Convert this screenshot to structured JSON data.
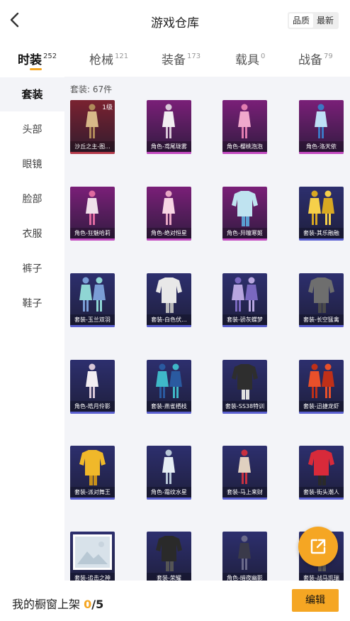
{
  "header": {
    "title": "游戏仓库",
    "sort_options": [
      "品质",
      "最新"
    ],
    "sort_active": "品质"
  },
  "tabs": [
    {
      "label": "时装",
      "count": "252",
      "active": true
    },
    {
      "label": "枪械",
      "count": "121"
    },
    {
      "label": "装备",
      "count": "173"
    },
    {
      "label": "载具",
      "count": "0"
    },
    {
      "label": "战备",
      "count": "79"
    }
  ],
  "sidebar": {
    "items": [
      "套装",
      "头部",
      "眼镜",
      "脸部",
      "衣服",
      "裤子",
      "鞋子"
    ],
    "active": "套装"
  },
  "content": {
    "count_label": "套装: 67件",
    "items": [
      {
        "name": "沙丘之主-图...",
        "level": "1级",
        "bg": "#7a2230",
        "bar": "#b43a4a",
        "icon": "figure-gold"
      },
      {
        "name": "角色-鸢尾珑雾",
        "bg": "#7a1f78",
        "bar": "#c24ac0",
        "icon": "figure-white-dress"
      },
      {
        "name": "角色-樱桃泡泡",
        "bg": "#7a1f78",
        "bar": "#c24ac0",
        "icon": "figure-pink-dress"
      },
      {
        "name": "角色-洛天依",
        "bg": "#7a1f78",
        "bar": "#c24ac0",
        "icon": "figure-blue-dress"
      },
      {
        "name": "角色-狂魅哈莉",
        "bg": "#7a1f78",
        "bar": "#c24ac0",
        "icon": "figure-harley"
      },
      {
        "name": "角色-绝对恒星",
        "bg": "#7a1f78",
        "bar": "#c24ac0",
        "icon": "figure-pink-gown"
      },
      {
        "name": "角色-异瞳寒姬",
        "bg": "#7a1f78",
        "bar": "#c24ac0",
        "icon": "figure-blue-outfit"
      },
      {
        "name": "套装-其乐融融",
        "bg": "#2d2f6e",
        "bar": "#5a5fd0",
        "icon": "figure-yellow-pair"
      },
      {
        "name": "套装-玉兰双羽",
        "bg": "#2d2f6e",
        "bar": "#5a5fd0",
        "icon": "figure-jade-pair"
      },
      {
        "name": "套装-白色伏...",
        "bg": "#2d2f6e",
        "bar": "#5a5fd0",
        "icon": "hoodie-white"
      },
      {
        "name": "套装-骄灰蝶梦",
        "bg": "#2d2f6e",
        "bar": "#5a5fd0",
        "icon": "figure-purple-pair"
      },
      {
        "name": "套装-长空猛禽",
        "bg": "#2d2f6e",
        "bar": "#5a5fd0",
        "icon": "jacket-camo"
      },
      {
        "name": "角色-皓月伶影",
        "bg": "#2d2f6e",
        "bar": "#5a5fd0",
        "icon": "figure-white-dress"
      },
      {
        "name": "套装-燕雀栖枝",
        "bg": "#2d2f6e",
        "bar": "#5a5fd0",
        "icon": "figure-teal-pair"
      },
      {
        "name": "套装-SS38特训",
        "bg": "#2d2f6e",
        "bar": "#5a5fd0",
        "icon": "outfit-dark"
      },
      {
        "name": "套装-迅捷龙虾",
        "bg": "#2d2f6e",
        "bar": "#5a5fd0",
        "icon": "figure-red-pair"
      },
      {
        "name": "套装-派对舞王",
        "bg": "#2d2f6e",
        "bar": "#5a5fd0",
        "icon": "outfit-gold"
      },
      {
        "name": "角色-霜纹水星",
        "bg": "#2d2f6e",
        "bar": "#5a5fd0",
        "icon": "figure-white-gown"
      },
      {
        "name": "套装-马上来财",
        "bg": "#2d2f6e",
        "bar": "#5a5fd0",
        "icon": "figure-red-skirt"
      },
      {
        "name": "套装-街头潮人",
        "bg": "#2d2f6e",
        "bar": "#5a5fd0",
        "icon": "jacket-red"
      },
      {
        "name": "套装-追击之神",
        "bg": "#2d2f6e",
        "bar": "#5a5fd0",
        "icon": "image-placeholder"
      },
      {
        "name": "套装-荣耀",
        "bg": "#2d2f6e",
        "bar": "#5a5fd0",
        "icon": "jacket-black"
      },
      {
        "name": "角色-暗夜幽影",
        "bg": "#2d2f6e",
        "bar": "#5a5fd0",
        "icon": "figure-dark"
      },
      {
        "name": "套装-战马凯瑞",
        "bg": "#2d2f6e",
        "bar": "#5a5fd0",
        "icon": "outfit-grey"
      }
    ]
  },
  "footer": {
    "label": "我的橱窗上架",
    "current": "0",
    "total": "/5",
    "edit_label": "编辑"
  },
  "colors": {
    "accent": "#f5a623",
    "panel_bg": "#f3f4f8"
  },
  "icons": {
    "back": "chevron-left-icon",
    "share": "external-link-icon"
  }
}
